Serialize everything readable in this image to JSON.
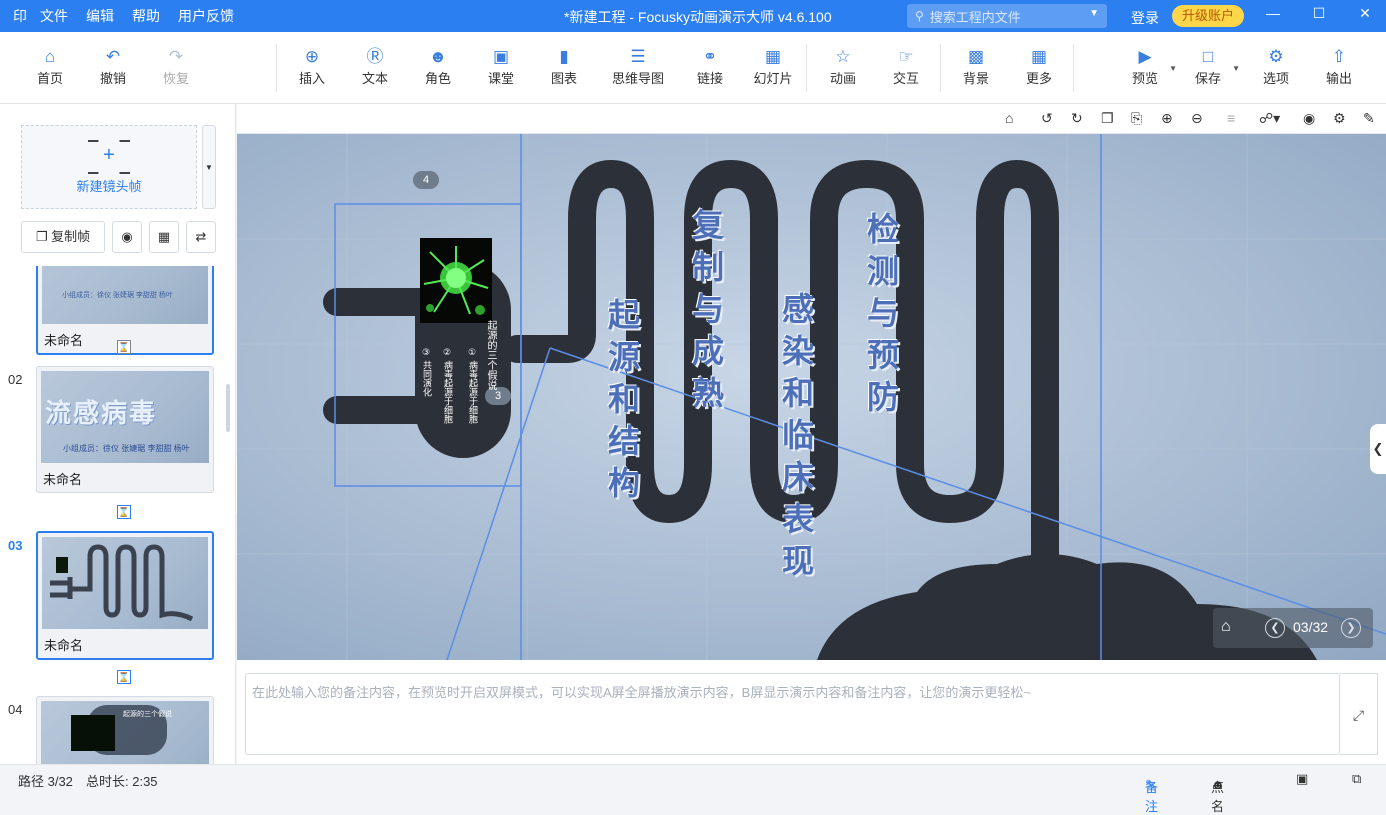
{
  "titlebar": {
    "logo": "印",
    "menu": [
      "文件",
      "编辑",
      "帮助",
      "用户反馈"
    ],
    "title": "*新建工程 - Focusky动画演示大师  v4.6.100",
    "search_placeholder": "搜索工程内文件",
    "login": "登录",
    "upgrade": "升级账户"
  },
  "toolbar": {
    "home": "首页",
    "undo": "撤销",
    "redo": "恢复",
    "insert": "插入",
    "text": "文本",
    "role": "角色",
    "classroom": "课堂",
    "chart": "图表",
    "mindmap": "思维导图",
    "link": "链接",
    "slide": "幻灯片",
    "animation": "动画",
    "interaction": "交互",
    "background": "背景",
    "more": "更多",
    "preview": "预览",
    "save": "保存",
    "options": "选项",
    "export": "输出"
  },
  "leftpanel": {
    "new_frame": "新建镜头帧",
    "copy_frame": "复制帧",
    "thumbs": [
      {
        "num": "",
        "caption": "未命名",
        "slide_text": "小组成员：徐仪 张婕琚 李甜甜 杨叶"
      },
      {
        "num": "02",
        "caption": "未命名",
        "slide_title": "流感病毒",
        "slide_text": "小组成员：徐仪 张婕琚 李甜甜 杨叶"
      },
      {
        "num": "03",
        "caption": "未命名"
      },
      {
        "num": "04",
        "caption": "",
        "slide_title": "起源的三个假说"
      }
    ]
  },
  "canvas": {
    "col1": "起源和结构",
    "col2": "复制与成熟",
    "col3": "感染和临床表现",
    "col4": "检测与预防",
    "frame_label_4": "4",
    "frame_label_3": "3",
    "card_title": "起源的三个假说",
    "card_item1": "① 病毒起源于细胞",
    "card_item2": "② 病毒起源于细胞",
    "card_item3": "③ 共同演化"
  },
  "nav": {
    "count": "03/32"
  },
  "notes": {
    "placeholder": "在此处输入您的备注内容，在预览时开启双屏模式，可以实现A屏全屏播放演示内容，B屏显示演示内容和备注内容，让您的演示更轻松~"
  },
  "status": {
    "path": "路径 3/32",
    "total": "总时长: 2:35",
    "notes": "备注",
    "rollcall": "点名"
  },
  "colors": {
    "accent": "#2b7ff0",
    "path": "#2b2f36",
    "title_text": "#4d6fb8",
    "canvas_bg": "#a9bdd3"
  }
}
